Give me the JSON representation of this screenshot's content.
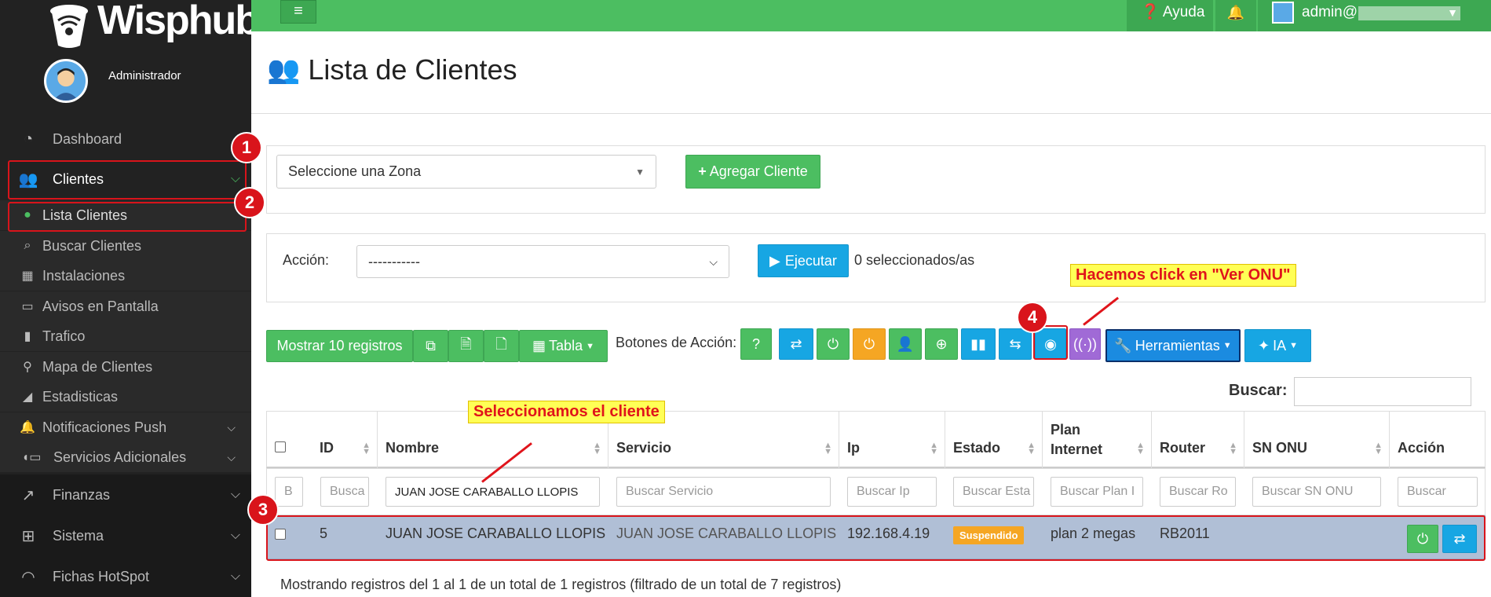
{
  "sidebar": {
    "logo": "Wisphub",
    "role": "Administrador",
    "items": [
      {
        "label": "Dashboard",
        "icon": "dashboard-icon"
      },
      {
        "label": "Clientes",
        "icon": "users-icon"
      },
      {
        "label": "Finanzas",
        "icon": "chart-line-icon"
      },
      {
        "label": "Sistema",
        "icon": "sitemap-icon"
      },
      {
        "label": "Fichas HotSpot",
        "icon": "wifi-icon"
      }
    ],
    "subitems": [
      {
        "label": "Lista Clientes",
        "icon": "users-icon"
      },
      {
        "label": "Buscar Clientes",
        "icon": "search-icon"
      },
      {
        "label": "Instalaciones",
        "icon": "calendar-icon"
      },
      {
        "label": "Avisos en Pantalla",
        "icon": "monitor-icon"
      },
      {
        "label": "Trafico",
        "icon": "bar-chart-icon"
      },
      {
        "label": "Mapa de Clientes",
        "icon": "map-marker-icon"
      },
      {
        "label": "Estadisticas",
        "icon": "area-chart-icon"
      },
      {
        "label": "Notificaciones Push",
        "icon": "bell-icon"
      },
      {
        "label": "Servicios Adicionales",
        "icon": "services-icon"
      }
    ]
  },
  "topbar": {
    "help": "Ayuda",
    "user": "admin@"
  },
  "page": {
    "title": "Lista de Clientes"
  },
  "zone": {
    "placeholder": "Seleccione una Zona",
    "add_button": "Agregar Cliente"
  },
  "action": {
    "label": "Acción:",
    "value": "-----------",
    "execute": "Ejecutar",
    "selected": "0 seleccionados/as"
  },
  "toolbar": {
    "show": "Mostrar 10 registros",
    "table": "Tabla",
    "buttons_label": "Botones de Acción:",
    "tools": "Herramientas",
    "ia": "IA"
  },
  "search": {
    "label": "Buscar:"
  },
  "table": {
    "headers": [
      "ID",
      "Nombre",
      "Servicio",
      "Ip",
      "Estado",
      "Plan Internet",
      "Router",
      "SN ONU",
      "Acción"
    ],
    "filters": [
      "B",
      "Busca",
      "JUAN JOSE CARABALLO LLOPIS",
      "Buscar Servicio",
      "Buscar Ip",
      "Buscar Esta",
      "Buscar Plan I",
      "Buscar Ro",
      "Buscar SN ONU",
      "Buscar"
    ],
    "rows": [
      {
        "id": "5",
        "nombre": "JUAN JOSE CARABALLO LLOPIS",
        "servicio": "JUAN JOSE CARABALLO LLOPIS",
        "ip": "192.168.4.19",
        "estado": "Suspendido",
        "plan": "plan 2 megas",
        "router": "RB2011",
        "sn": ""
      }
    ]
  },
  "footer": {
    "info": "Mostrando registros del 1 al 1 de un total de 1 registros (filtrado de un total de 7 registros)"
  },
  "annotations": {
    "select_client": "Seleccionamos el cliente",
    "click_onu": "Hacemos click en \"Ver ONU\"",
    "n1": "1",
    "n2": "2",
    "n3": "3",
    "n4": "4"
  },
  "colors": {
    "accent_green": "#4cbe61",
    "accent_blue": "#17a6e3",
    "annotation_red": "#d9141b",
    "status_orange": "#f5a623"
  }
}
